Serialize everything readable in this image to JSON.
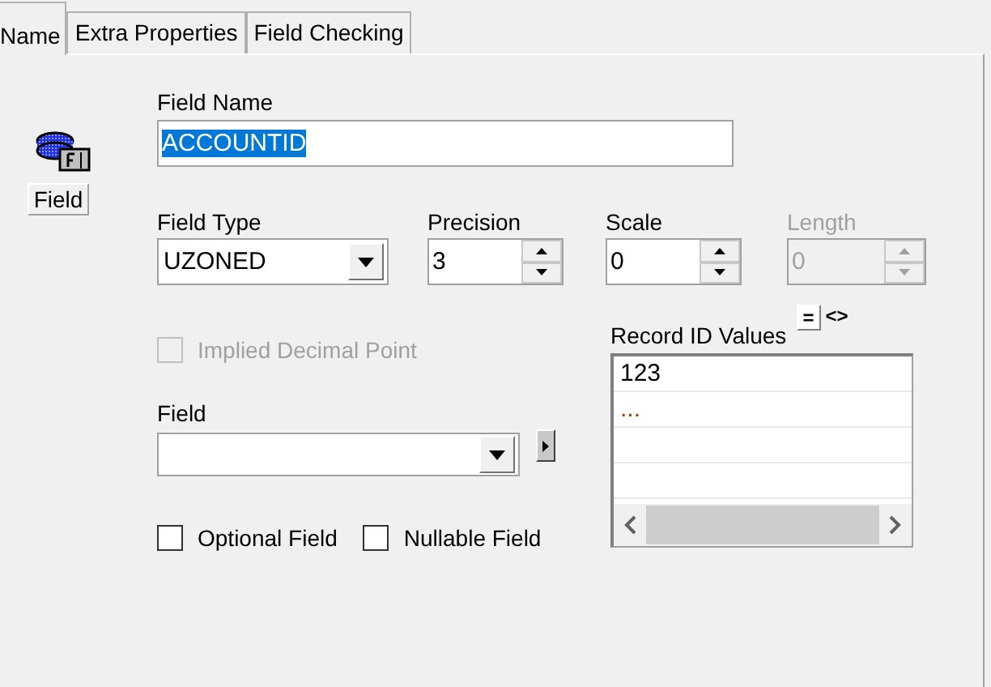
{
  "tabs": [
    {
      "label": "Name",
      "selected": true
    },
    {
      "label": "Extra Properties",
      "selected": false
    },
    {
      "label": "Field Checking",
      "selected": false
    }
  ],
  "object_label": "Field",
  "field_name": {
    "label": "Field Name",
    "value": "ACCOUNTID"
  },
  "field_type": {
    "label": "Field Type",
    "value": "UZONED"
  },
  "spinners": [
    {
      "label": "Precision",
      "value": "3",
      "disabled": false
    },
    {
      "label": "Scale",
      "value": "0",
      "disabled": false
    },
    {
      "label": "Length",
      "value": "0",
      "disabled": true
    }
  ],
  "implied_decimal": {
    "label": "Implied Decimal Point",
    "checked": false,
    "disabled": true
  },
  "field": {
    "label": "Field"
  },
  "record_id": {
    "label": "Record ID Values",
    "operators": [
      {
        "label": "=",
        "selected": true
      },
      {
        "label": "<>",
        "selected": false
      }
    ],
    "items": [
      {
        "text": "123",
        "kind": "value"
      },
      {
        "text": "...",
        "kind": "new"
      }
    ]
  },
  "options": [
    {
      "label": "Optional Field",
      "checked": false
    },
    {
      "label": "Nullable Field",
      "checked": false
    }
  ]
}
